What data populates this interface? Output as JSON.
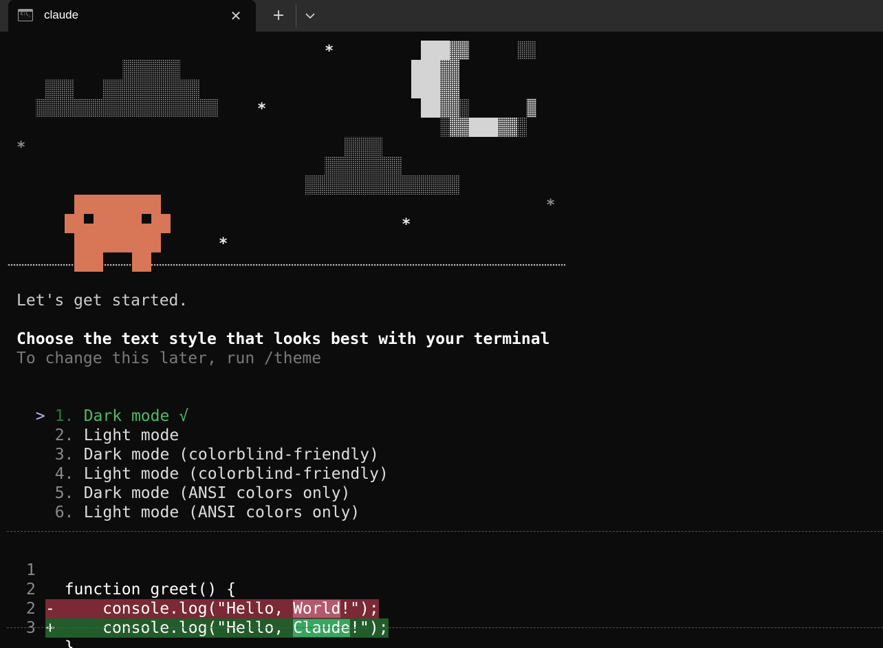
{
  "window": {
    "tab_title": "claude",
    "tab_icon": "terminal-icon",
    "close_icon": "close-icon",
    "new_tab_icon": "plus-icon",
    "dropdown_icon": "chevron-down-icon"
  },
  "art": {
    "stars": [
      "*",
      "*",
      "*",
      "*",
      "*",
      "*"
    ],
    "mascot_color": "#d77757"
  },
  "content": {
    "intro": "Let's get started.",
    "heading": "Choose the text style that looks best with your terminal",
    "hint": "To change this later, run /theme",
    "pointer": ">",
    "options": [
      {
        "num": "1.",
        "label": "Dark mode",
        "check": "√",
        "selected": true
      },
      {
        "num": "2.",
        "label": "Light mode"
      },
      {
        "num": "3.",
        "label": "Dark mode (colorblind-friendly)"
      },
      {
        "num": "4.",
        "label": "Light mode (colorblind-friendly)"
      },
      {
        "num": "5.",
        "label": "Dark mode (ANSI colors only)"
      },
      {
        "num": "6.",
        "label": "Light mode (ANSI colors only)"
      }
    ]
  },
  "diff": {
    "lines": [
      {
        "ln": "1",
        "marker": "",
        "code": "function greet() {"
      },
      {
        "ln": "2",
        "marker": "-",
        "pre": "    console.log(\"Hello, ",
        "hl": "World",
        "post": "!\");"
      },
      {
        "ln": "2",
        "marker": "+",
        "pre": "    console.log(\"Hello, ",
        "hl": "Claude",
        "post": "!\");"
      },
      {
        "ln": "3",
        "marker": "",
        "code": "}"
      }
    ]
  },
  "colors": {
    "background": "#0c0c0c",
    "selected": "#4eba65",
    "pointer": "#b1b9f9",
    "removed_bg": "#7a2935",
    "added_bg": "#225c2b"
  }
}
